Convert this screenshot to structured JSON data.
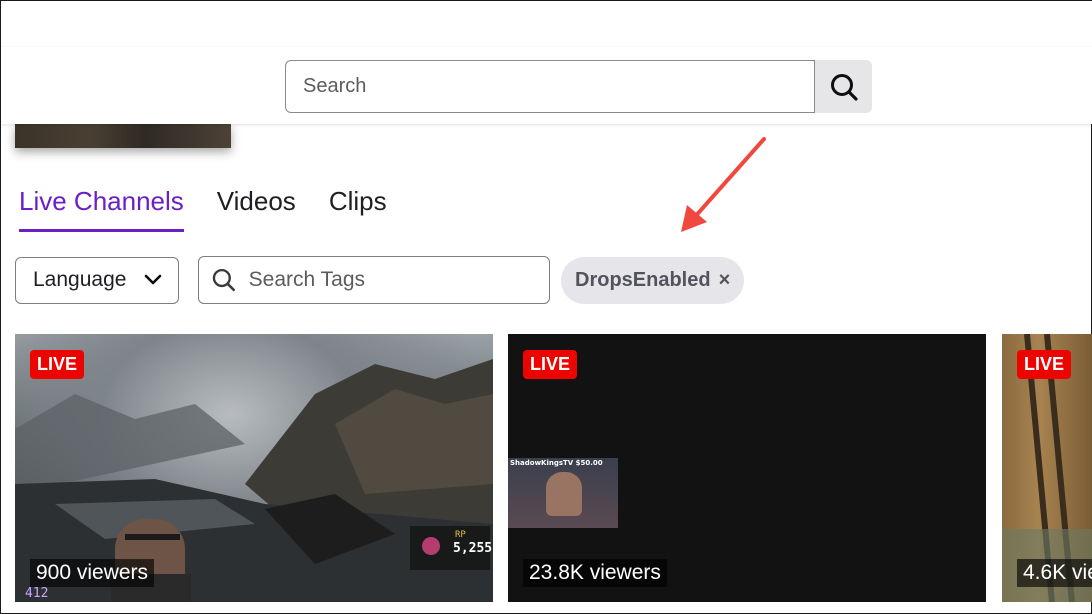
{
  "search": {
    "placeholder": "Search"
  },
  "tabs": [
    {
      "label": "Live Channels"
    },
    {
      "label": "Videos"
    },
    {
      "label": "Clips"
    }
  ],
  "filters": {
    "language_label": "Language",
    "tag_search_placeholder": "Search Tags",
    "active_tag": "DropsEnabled",
    "remove_glyph": "×"
  },
  "streams": [
    {
      "live_label": "LIVE",
      "viewers": "900 viewers",
      "overlay_rp_label": "RP",
      "overlay_rp_value": "5,255",
      "overlay_counter": "412"
    },
    {
      "live_label": "LIVE",
      "viewers": "23.8K viewers",
      "webcam_title": "ShadowKingsTV  $50.00"
    },
    {
      "live_label": "LIVE",
      "viewers": "4.6K vie"
    }
  ],
  "colors": {
    "accent": "#6b1fc7",
    "live": "#eb0400",
    "annotation_arrow": "#f0483e"
  }
}
